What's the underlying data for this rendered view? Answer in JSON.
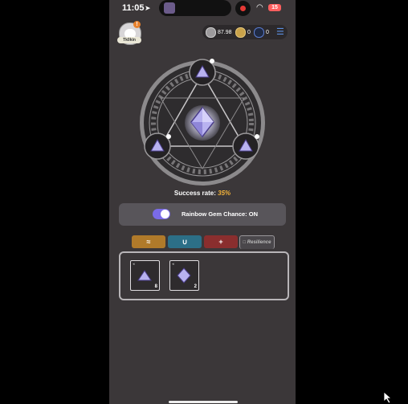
{
  "status_bar": {
    "time": "11:05",
    "battery": "15"
  },
  "profile": {
    "username": "Tk0kin",
    "notification_count": "!"
  },
  "currencies": [
    {
      "name": "silver-coin",
      "value": "87.98",
      "color": "#9c9a9c"
    },
    {
      "name": "gold-coin",
      "value": "0",
      "color": "#c9a24a"
    },
    {
      "name": "token",
      "value": "0",
      "color": "#1f2a44"
    }
  ],
  "forge": {
    "success_label": "Success rate:",
    "success_rate": "35%"
  },
  "rainbow_toggle": {
    "label": "Rainbow Gem Chance: ON",
    "on": true
  },
  "tabs": [
    {
      "label": "≈",
      "color": "#b07a2a"
    },
    {
      "label": "∪",
      "color": "#2c6f87"
    },
    {
      "label": "+",
      "color": "#8a2e2e"
    },
    {
      "label": "□ Resilience",
      "active": true
    }
  ],
  "inventory": [
    {
      "gem": "triangle-gem",
      "count": "8"
    },
    {
      "gem": "diamond-gem",
      "count": "2"
    }
  ],
  "colors": {
    "accent": "#7a6be8",
    "rate": "#f2b23a"
  }
}
